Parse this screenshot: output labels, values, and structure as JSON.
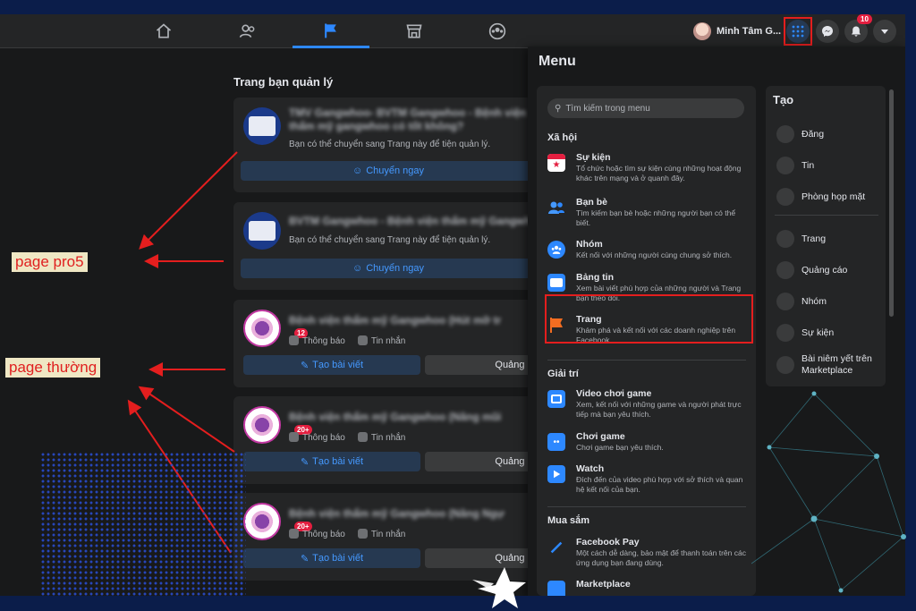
{
  "topnav": {
    "tabs": [
      {
        "icon": "home-icon"
      },
      {
        "icon": "friends-icon"
      },
      {
        "icon": "pages-flag-icon",
        "active": true
      },
      {
        "icon": "marketplace-icon"
      },
      {
        "icon": "groups-icon"
      }
    ],
    "profile_name": "Minh Tâm G...",
    "notification_count": "10"
  },
  "left": {
    "section_title": "Trang bạn quản lý",
    "cards": [
      {
        "name": "TMV Gangwhoo- BVTM Gangwhoo - Bệnh viện thẩm mỹ gangwhoo có tốt không?",
        "sub": "Bạn có thể chuyển sang Trang này để tiện quản lý.",
        "button": "Chuyển ngay"
      },
      {
        "name": "BVTM Gangwhoo - Bệnh viện thẩm mỹ Gangwhoo",
        "sub": "Bạn có thể chuyển sang Trang này để tiện quản lý.",
        "button": "Chuyển ngay"
      },
      {
        "name": "Bệnh viện thẩm mỹ Gangwhoo (Hút mỡ tr",
        "notif_label": "Thông báo",
        "msg_label": "Tin nhắn",
        "badge": "12",
        "create_button": "Tạo bài viết",
        "manage_button": "Quảng c"
      },
      {
        "name": "Bệnh viện thẩm mỹ Gangwhoo (Nâng mũi",
        "notif_label": "Thông báo",
        "msg_label": "Tin nhắn",
        "badge": "20+",
        "create_button": "Tạo bài viết",
        "manage_button": "Quảng c"
      },
      {
        "name": "Bệnh viện thẩm mỹ Gangwhoo (Nâng Ngự",
        "notif_label": "Thông báo",
        "msg_label": "Tin nhắn",
        "badge": "20+",
        "create_button": "Tạo bài viết",
        "manage_button": "Quảng c"
      }
    ]
  },
  "annotations": {
    "label_pro5": "page pro5",
    "label_normal": "page thường",
    "arrow_color": "#e41e1e"
  },
  "menu": {
    "title": "Menu",
    "search_placeholder": "Tìm kiếm trong menu",
    "categories": [
      {
        "label": "Xã hội",
        "items": [
          {
            "label": "Sự kiện",
            "desc": "Tổ chức hoặc tìm sự kiện cùng những hoạt động khác trên mạng và ở quanh đây.",
            "icon": "calendar-star-icon"
          },
          {
            "label": "Bạn bè",
            "desc": "Tìm kiếm bạn bè hoặc những người bạn có thể biết.",
            "icon": "friends-icon"
          },
          {
            "label": "Nhóm",
            "desc": "Kết nối với những người cùng chung sở thích.",
            "icon": "groups-icon"
          },
          {
            "label": "Bảng tin",
            "desc": "Xem bài viết phù hợp của những người và Trang bạn theo dõi.",
            "icon": "news-feed-icon"
          },
          {
            "label": "Trang",
            "desc": "Khám phá và kết nối với các doanh nghiệp trên Facebook.",
            "icon": "flag-icon",
            "highlighted": true
          }
        ]
      },
      {
        "label": "Giải trí",
        "items": [
          {
            "label": "Video chơi game",
            "desc": "Xem, kết nối với những game và người phát trực tiếp mà bạn yêu thích.",
            "icon": "gaming-video-icon"
          },
          {
            "label": "Chơi game",
            "desc": "Chơi game bạn yêu thích.",
            "icon": "gamepad-icon"
          },
          {
            "label": "Watch",
            "desc": "Đích đến của video phù hợp với sở thích và quan hệ kết nối của bạn.",
            "icon": "watch-play-icon"
          }
        ]
      },
      {
        "label": "Mua sắm",
        "items": [
          {
            "label": "Facebook Pay",
            "desc": "Một cách dễ dàng, bảo mật để thanh toán trên các ứng dụng bạn đang dùng.",
            "icon": "pay-icon"
          },
          {
            "label": "Marketplace",
            "desc": "",
            "icon": "marketplace-icon"
          }
        ]
      }
    ]
  },
  "create": {
    "title": "Tạo",
    "items": [
      "Đăng",
      "Tin",
      "Phòng họp mặt",
      "Trang",
      "Quảng cáo",
      "Nhóm",
      "Sự kiện",
      "Bài niêm yết trên Marketplace"
    ]
  }
}
